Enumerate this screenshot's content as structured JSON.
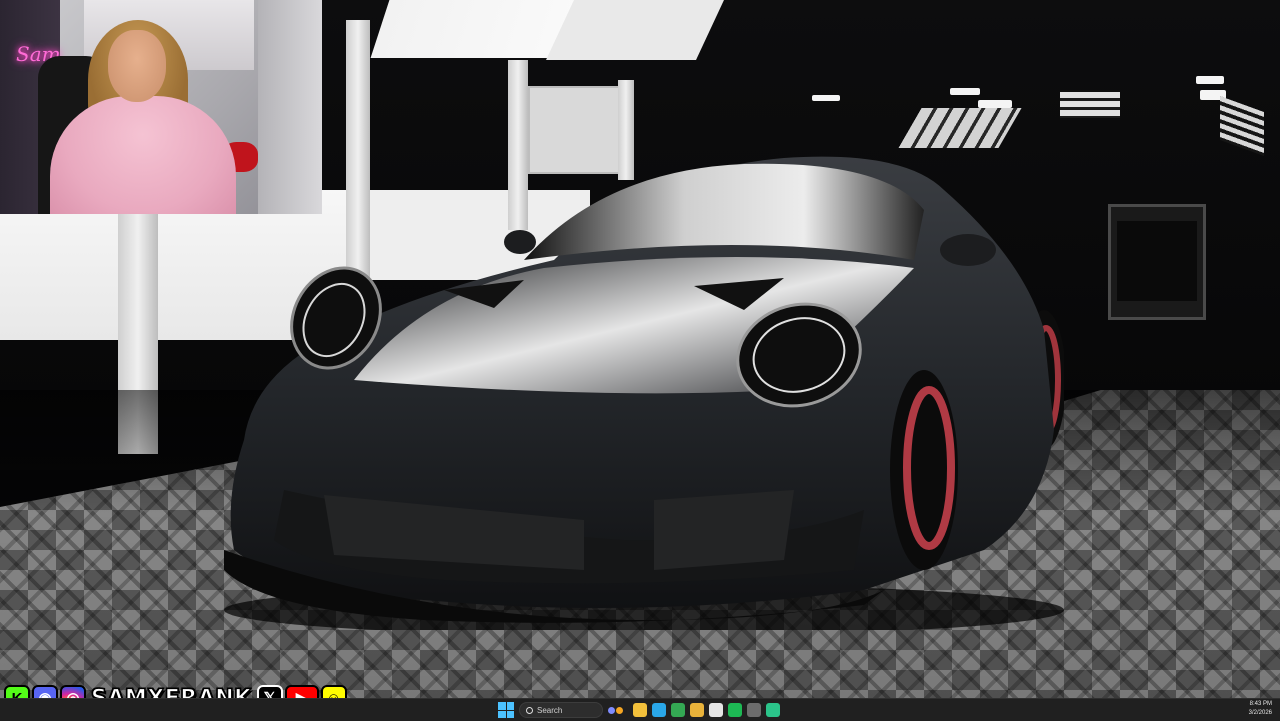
{
  "webcam": {
    "neon_sign": "Sam"
  },
  "social": {
    "handle": "SAMXFRANK",
    "icons": [
      {
        "name": "kick-icon",
        "glyph": "K",
        "color": "#53fc18"
      },
      {
        "name": "discord-icon",
        "glyph": "◉",
        "color": "#5865f2"
      },
      {
        "name": "instagram-icon",
        "glyph": "◎",
        "color": "#d6249f"
      },
      {
        "name": "x-icon",
        "glyph": "𝕏",
        "color": "#000000"
      },
      {
        "name": "youtube-icon",
        "glyph": "▶",
        "color": "#ff0000"
      },
      {
        "name": "snapchat-icon",
        "glyph": "☺",
        "color": "#fffc00"
      }
    ]
  },
  "taskbar": {
    "search_placeholder": "Search",
    "clock_time": "8:43 PM",
    "clock_date": "3/2/2026",
    "apps": [
      {
        "name": "file-explorer-icon",
        "color": "#f3c03b"
      },
      {
        "name": "edge-icon",
        "color": "#2aa7e8"
      },
      {
        "name": "chrome-icon",
        "color": "#34a853"
      },
      {
        "name": "folder-icon",
        "color": "#e8b23a"
      },
      {
        "name": "calendar-icon",
        "color": "#e5e5e5"
      },
      {
        "name": "spotify-icon",
        "color": "#1db954"
      },
      {
        "name": "obs-icon",
        "color": "#6c6c6c"
      },
      {
        "name": "app-icon",
        "color": "#2bc48a"
      }
    ]
  }
}
